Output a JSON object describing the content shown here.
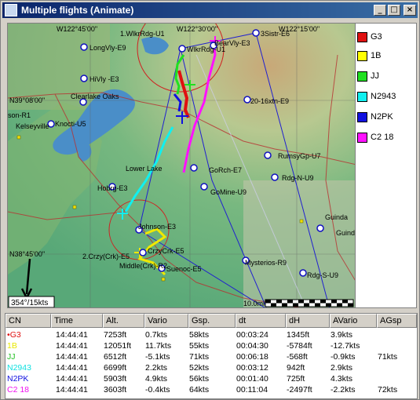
{
  "window": {
    "title": "Multiple flights (Animate)",
    "buttons": [
      "_",
      "□",
      "×"
    ]
  },
  "map": {
    "coord_labels": [
      "W122°45'00\"",
      "W122°30'00\"",
      "W122°15'00\"",
      "N39°08'00\"",
      "N38°45'00\""
    ],
    "wind_label": "354°/15kts",
    "scale_label": "10.0mi",
    "places": [
      "1.WlkrRdg-U1",
      "WlkrRdg-U1",
      "BearVly-E3",
      "3Sistr-E6",
      "LongVly-E9",
      "HiVly -E3",
      "Clearlake Oaks",
      "20-16xtn-E9",
      "son-R1",
      "Kelseyville",
      "Knocti-U5",
      "Lower Lake",
      "GoRch-E7",
      "RumsyGp-U7",
      "Rdg-N-U9",
      "Hobrg-E3",
      "GoMine-U9",
      "Guinda",
      "Guinda",
      "Johnson-E3",
      "2.Crzy(Crk)-E5",
      "CrzyCrk-E5",
      "Middle(Crk)-R2",
      "Suenoc-E5",
      "Mysterios-R9",
      "Rdg-S-U9"
    ]
  },
  "legend": {
    "items": [
      {
        "label": "G3",
        "color": "#e01010"
      },
      {
        "label": "1B",
        "color": "#ffff00"
      },
      {
        "label": "JJ",
        "color": "#20e020"
      },
      {
        "label": "N2943",
        "color": "#10f0f0"
      },
      {
        "label": "N2PK",
        "color": "#1010e0"
      },
      {
        "label": "C2 18",
        "color": "#ff10ff"
      }
    ]
  },
  "table": {
    "headers": [
      "CN",
      "Time",
      "Alt.",
      "Vario",
      "Gsp.",
      "dt",
      "dH",
      "AVario",
      "AGsp"
    ],
    "rows": [
      {
        "cn": "G3",
        "marker": "•",
        "color": "#e01010",
        "cells": [
          "14:44:41",
          "7253ft",
          "0.7kts",
          "58kts",
          "00:03:24",
          "1345ft",
          "3.9kts",
          ""
        ]
      },
      {
        "cn": "1B",
        "marker": "",
        "color": "#e8e800",
        "cells": [
          "14:44:41",
          "12051ft",
          "11.7kts",
          "55kts",
          "00:04:30",
          "-5784ft",
          "-12.7kts",
          ""
        ]
      },
      {
        "cn": "JJ",
        "marker": "",
        "color": "#20c020",
        "cells": [
          "14:44:41",
          "6512ft",
          "-5.1kts",
          "71kts",
          "00:06:18",
          "-568ft",
          "-0.9kts",
          "71kts"
        ]
      },
      {
        "cn": "N2943",
        "marker": "",
        "color": "#10e0e0",
        "cells": [
          "14:44:41",
          "6699ft",
          "2.2kts",
          "52kts",
          "00:03:12",
          "942ft",
          "2.9kts",
          ""
        ]
      },
      {
        "cn": "N2PK",
        "marker": "",
        "color": "#1010e0",
        "cells": [
          "14:44:41",
          "5903ft",
          "4.9kts",
          "56kts",
          "00:01:40",
          "725ft",
          "4.3kts",
          ""
        ]
      },
      {
        "cn": "C2 18",
        "marker": "",
        "color": "#f010f0",
        "cells": [
          "14:44:41",
          "3603ft",
          "-0.4kts",
          "64kts",
          "00:11:04",
          "-2497ft",
          "-2.2kts",
          "72kts"
        ]
      }
    ]
  }
}
